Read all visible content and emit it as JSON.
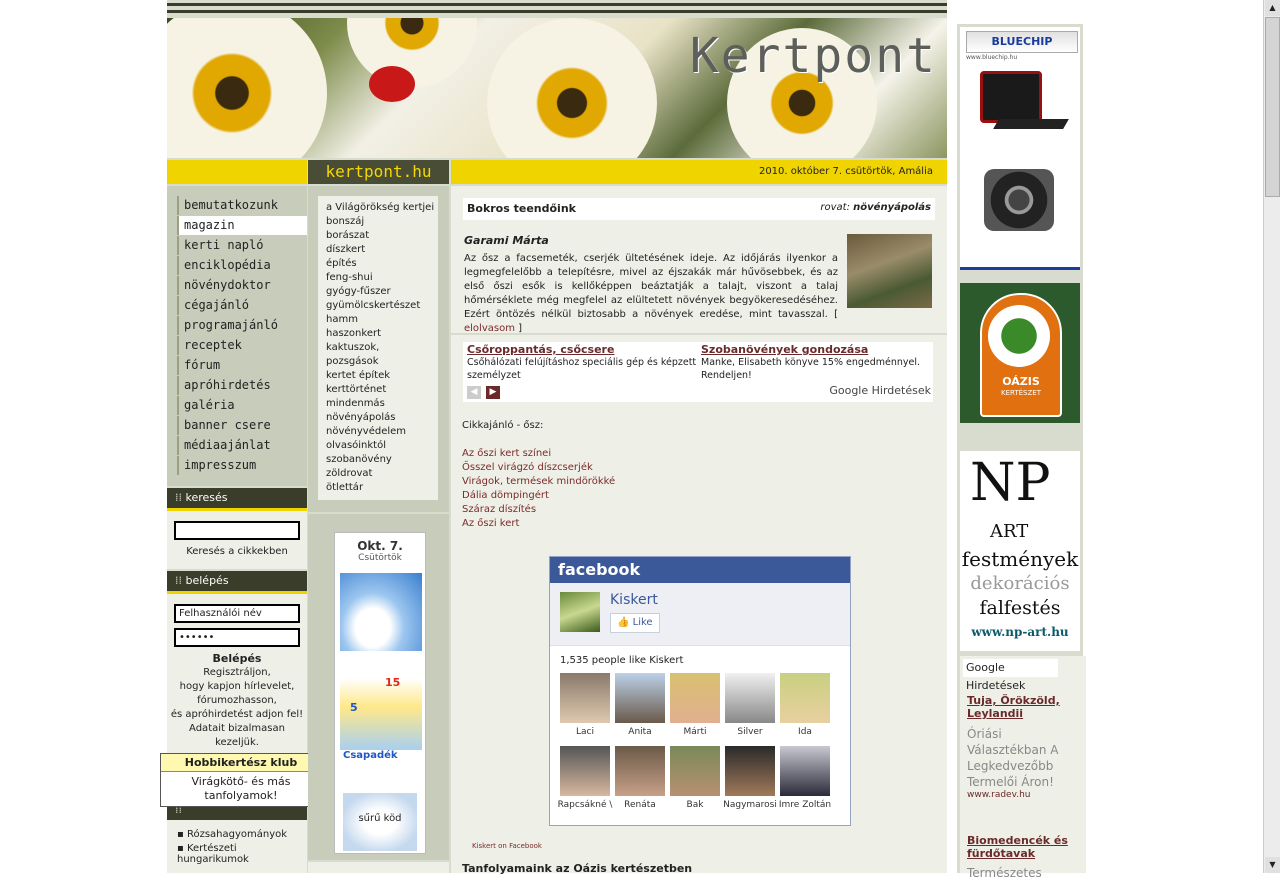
{
  "header": {
    "logo": "Kertpont",
    "site_name": "kertpont.hu",
    "date": "2010. október 7. csütörtök,  Amália"
  },
  "nav": {
    "items": [
      "bemutatkozunk",
      "magazin",
      "kerti napló",
      "enciklopédia",
      "növénydoktor",
      "cégajánló",
      "programajánló",
      "receptek",
      "fórum",
      "apróhirdetés",
      "galéria",
      "banner csere",
      "médiaajánlat",
      "impresszum"
    ]
  },
  "search": {
    "heading": "keresés",
    "placeholder": "",
    "caption": "Keresés a cikkekben"
  },
  "login": {
    "heading": "belépés",
    "username": "Felhasználói név",
    "password": "••••••",
    "button": "Belépés",
    "text": [
      "Regisztráljon,",
      "hogy kapjon hírlevelet,",
      "fórumozhasson,",
      "és apróhirdetést adjon fel!",
      "Adatait bizalmasan",
      "kezeljük."
    ]
  },
  "club_popup": {
    "title": "Hobbikertész klub",
    "body": "Virágkötő- és más tanfolyamok!"
  },
  "left_bottom_links": [
    "Rózsahagyományok",
    "Kertészeti hungarikumok"
  ],
  "topics": [
    "a Világörökség kertjei",
    "bonszáj",
    "borászat",
    "díszkert",
    "építés",
    "feng-shui",
    "gyógy-fűszer",
    "gyümölcskertészet",
    "hamm",
    "haszonkert",
    "kaktuszok,",
    "pozsgások",
    "kertet építek",
    "kerttörténet",
    "mindenmás",
    "növényápolás",
    "növényvédelem",
    "olvasóinktól",
    "szobanövény",
    "zöldrovat",
    "ötlettár"
  ],
  "weather": {
    "date": "Okt. 7.",
    "day": "Csütörtök",
    "temp_high": "15",
    "temp_low": "5",
    "precip_label": "Csapadék",
    "fog_label": "sűrű köd"
  },
  "article": {
    "title": "Bokros teendőink",
    "rovat_label": "rovat:",
    "rovat": "növényápolás",
    "author": "Garami Márta",
    "text": "Az ősz a facsemeték, cserjék ültetésének ideje. Az időjárás ilyenkor a legmegfelelőbb a telepítésre, mivel az éjszakák már hűvösebbek, és az első őszi esők is kellőképpen beáztatják a talajt, viszont a talaj hőmérséklete még megfelel az elültetett növények begyökeresedéséhez. Ezért öntözés nélkül biztosabb a növények eredése, mint tavasszal. [",
    "more": "elolvasom",
    "close": "]"
  },
  "google_ads": {
    "ad1_title": "Csőroppantás, csőcsere",
    "ad1_text": "Csőhálózati felújításhoz speciális gép és képzett személyzet",
    "ad2_title": "Szobanövények gondozása",
    "ad2_text": "Manke, Elisabeth könyve 15% engedménnyel. Rendeljen!",
    "brand": "Google Hirdetések"
  },
  "recommend": {
    "heading": "Cikkajánló - ősz:",
    "links": [
      "Az őszi kert színei",
      "Ősszel virágzó díszcserjék",
      "Virágok, termések mindörökké",
      "Dália dömpingért",
      "Száraz díszítés",
      "Az őszi kert"
    ]
  },
  "facebook": {
    "brand": "facebook",
    "page": "Kiskert",
    "like": "Like",
    "count_text": "1,535 people like Kiskert",
    "fans": [
      "Laci",
      "Anita",
      "Márti",
      "Silver",
      "Ida",
      "Rapcsákné \\",
      "Renáta",
      "Bak",
      "Nagymarosi",
      "Imre Zoltán"
    ],
    "footer": "Kiskert on Facebook"
  },
  "courses_heading": "Tanfolyamaink az Oázis kertészetben",
  "right_ads": {
    "bluechip": "BLUECHIP",
    "bluechip_url": "www.bluechip.hu",
    "oazis": "OÁZIS",
    "oazis_sub": "KERTÉSZET",
    "np_logo": "NP",
    "np_art": "ART",
    "np_line1": "festmények",
    "np_line2": "dekorációs",
    "np_line3": "falfestés",
    "np_url": "www.np-art.hu",
    "google_brand": "Google Hirdetések",
    "g1_title": "Tuja, Örökzöld, Leylandii",
    "g1_text": "Óriási Választékban A Legkedvezőbb Termelői Áron!",
    "g1_url": "www.radev.hu",
    "g2_title": "Biomedencék és fürdőtavak",
    "g2_text": "Természetes"
  }
}
